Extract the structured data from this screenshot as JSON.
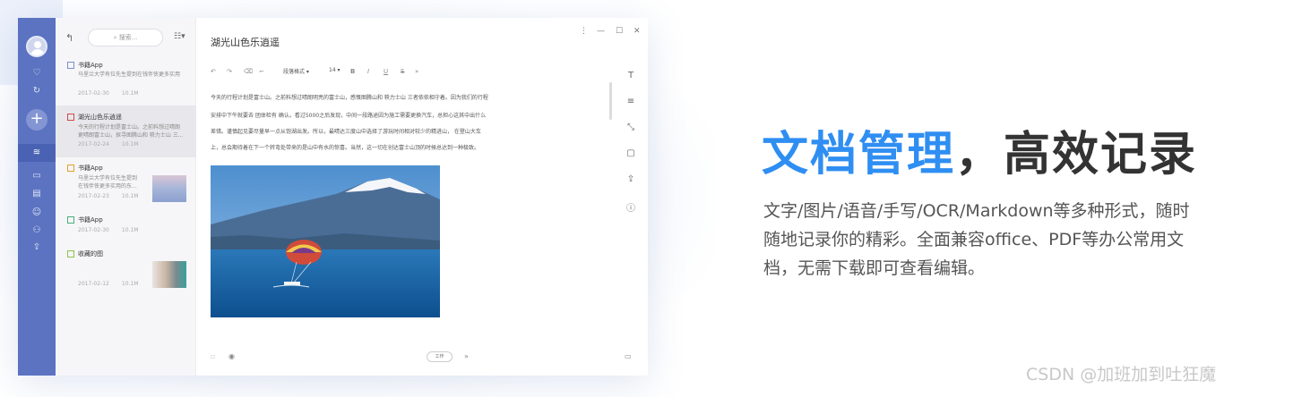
{
  "editor": {
    "title": "湖光山色乐逍遥",
    "toolbar": {
      "undo": "↶",
      "redo": "↷",
      "eraser": "⌫",
      "format_painter": "⌐",
      "paragraph_style": "段落格式",
      "font_size": "14",
      "bold": "B",
      "italic": "I",
      "underline": "U",
      "strike": "S",
      "more": "»"
    },
    "window": {
      "menu": "⋮",
      "minimize": "—",
      "maximize": "☐",
      "close": "✕"
    },
    "paragraphs": [
      "今天的行程计划是富士山。之前料想过晴朗明亮的富士山，感慨图腾山和  轶力士山  三者依依相守着。因为我们的行程",
      "安排中下午就要去  团体检有  确认。看过5000之后发现，中间一段路途因为施工需要更换汽车，总担心这其中出什么",
      "差错。谨慎起见要尽量早一点从饱湖出发。所以，最晴达三度山中选择了游玩时间相对较少的精进山，  在登山大车",
      "上，总会期待着在下一个转弯处带来的是山中有水的惊喜。当然，这一切在创达富士山顶的时候总达到一种极致。"
    ],
    "footer": {
      "tag": "工作",
      "more": "»"
    },
    "side_tools": [
      "T",
      "≡",
      "⤡",
      "▢",
      "⇪",
      "ⓘ"
    ],
    "image_alt": "lake-parasail-photo"
  },
  "list": {
    "search_placeholder": "搜索...",
    "back": "↰",
    "view_toggle": "☷▾",
    "notes": [
      {
        "title": "书籍App",
        "snippet": [
          "马里兰大学有位先生提到在钱伴侠更多实用"
        ],
        "date": "2017-02-30",
        "size": "10.1M"
      },
      {
        "title": "湖光山色乐逍遥",
        "snippet": [
          "今天的行程计划是富士山。之前料想过晴朗",
          "更晴朗富士山，探寻图腾山和 轶力士山  三..."
        ],
        "date": "2017-02-24",
        "size": "10.1M"
      },
      {
        "title": "书籍App",
        "snippet": [
          "马里兰大学有位先生提到",
          "在钱伴侠更多实用的东..."
        ],
        "date": "2017-02-23",
        "size": "10.1M"
      },
      {
        "title": "书籍App",
        "snippet": [],
        "date": "2017-02-30",
        "size": "10.1M"
      },
      {
        "title": "收藏的图",
        "snippet": [],
        "date": "2017-02-12",
        "size": "10.1M"
      }
    ]
  },
  "rail": {
    "heart": "♡",
    "refresh": "↻",
    "add": "+",
    "items": [
      "≋",
      "▭",
      "▤",
      "☺",
      "⚇",
      "⇪"
    ]
  },
  "marketing": {
    "headline_highlight": "文档管理",
    "headline_rest": "，高效记录",
    "body_lines": [
      "文字/图片/语音/手写/OCR/Markdown等多种形式，随时",
      "随地记录你的精彩。全面兼容office、PDF等办公常用文",
      "档，无需下载即可查看编辑。"
    ],
    "watermark": "CSDN @加班加到吐狂魔"
  },
  "colors": {
    "accent": "#2f8ef2",
    "rail": "#5b73c1",
    "headline": "#333333"
  }
}
